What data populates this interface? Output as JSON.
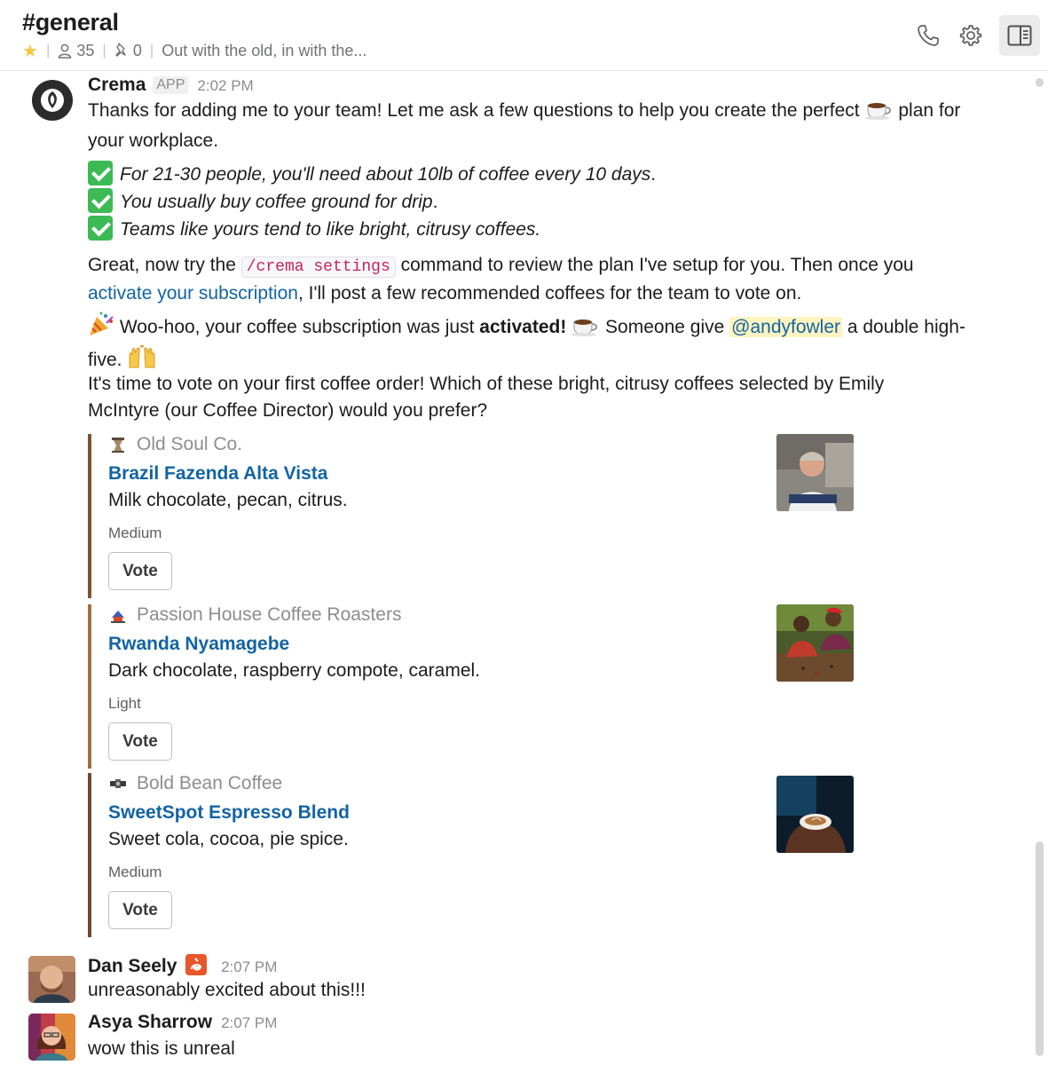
{
  "header": {
    "channel": "#general",
    "members": "35",
    "pins": "0",
    "topic": "Out with the old, in with the..."
  },
  "colors": {
    "link": "#1264a3",
    "attachment_bar_1": "#7b5431",
    "attachment_bar_2": "#a0703f",
    "attachment_bar_3": "#6e4a2b",
    "star": "#f2c744"
  },
  "messages": {
    "crema": {
      "sender": "Crema",
      "badge": "APP",
      "time": "2:02 PM",
      "intro_line1": "Thanks for adding me to your team! Let me ask a few questions to help you create the perfect",
      "intro_line1_end": "plan for",
      "intro_line2": "your workplace.",
      "check1": "For 21-30 people, you'll need about 10lb of coffee every 10 days",
      "check2": "You usually buy coffee ground for drip",
      "check3": "Teams like yours tend to like bright, citrusy coffees.",
      "period": ".",
      "great_a": "Great, now try the",
      "command": "/crema settings",
      "great_b": "command to review the plan I've setup for you. Then once you",
      "activate_link": "activate your subscription",
      "great_c": ", I'll post a few recommended coffees for the team to vote on.",
      "woohoo_a": "Woo-hoo, your coffee subscription was just",
      "activated": "activated!",
      "woohoo_b": "Someone give",
      "mention": "@andyfowler",
      "woohoo_c": "a double high-",
      "woohoo_d": "five.",
      "vote_intro_1": "It's time to vote on your first coffee order! Which of these bright, citrusy coffees selected by Emily",
      "vote_intro_2": "McIntyre (our Coffee Director) would you prefer?"
    },
    "attachments": [
      {
        "roaster": "Old Soul Co.",
        "title": "Brazil Fazenda Alta Vista",
        "notes": "Milk chocolate, pecan, citrus.",
        "roast": "Medium",
        "button": "Vote"
      },
      {
        "roaster": "Passion House Coffee Roasters",
        "title": "Rwanda Nyamagebe",
        "notes": "Dark chocolate, raspberry compote, caramel.",
        "roast": "Light",
        "button": "Vote"
      },
      {
        "roaster": "Bold Bean Coffee",
        "title": "SweetSpot Espresso Blend",
        "notes": "Sweet cola, cocoa, pie spice.",
        "roast": "Medium",
        "button": "Vote"
      }
    ],
    "dan": {
      "sender": "Dan Seely",
      "time": "2:07 PM",
      "text": "unreasonably excited about this!!!"
    },
    "asya": {
      "sender": "Asya Sharrow",
      "time": "2:07 PM",
      "text": "wow this is unreal"
    }
  }
}
